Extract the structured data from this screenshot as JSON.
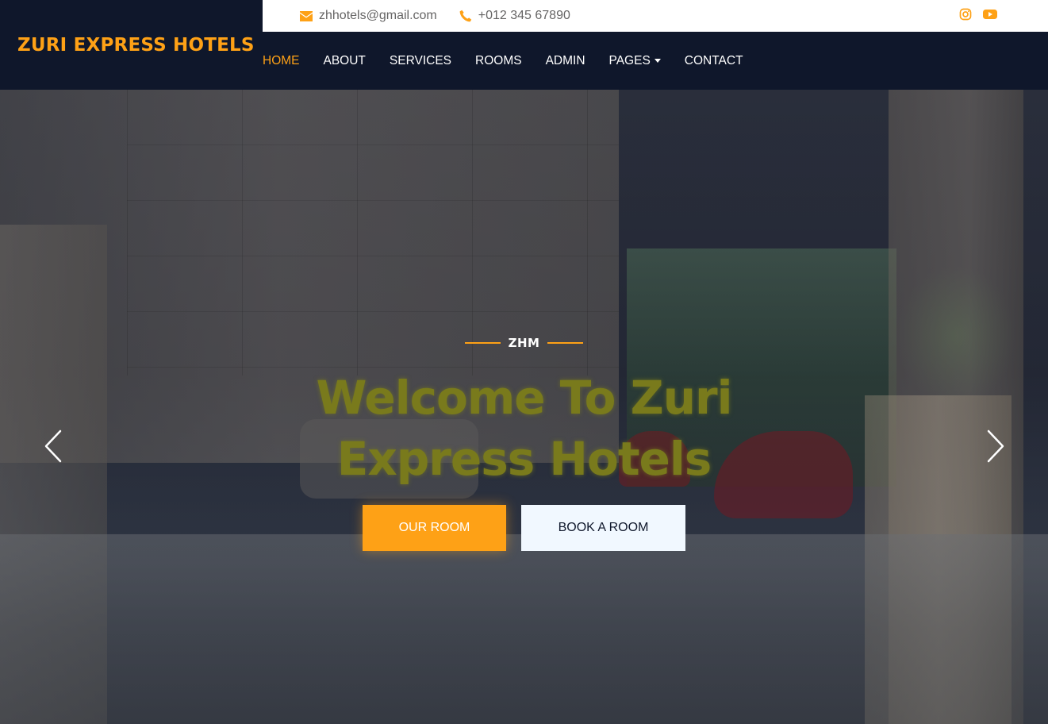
{
  "brand": {
    "name": "ZURI EXPRESS HOTELS"
  },
  "topbar": {
    "email": "zhhotels@gmail.com",
    "phone": "+012 345 67890",
    "socials": [
      "instagram-icon",
      "youtube-icon"
    ]
  },
  "nav": {
    "items": [
      {
        "label": "HOME",
        "active": true
      },
      {
        "label": "ABOUT"
      },
      {
        "label": "SERVICES"
      },
      {
        "label": "ROOMS"
      },
      {
        "label": "ADMIN"
      },
      {
        "label": "PAGES",
        "dropdown": true
      },
      {
        "label": "CONTACT"
      }
    ]
  },
  "hero": {
    "subtitle": "ZHM",
    "headline_line1": "Welcome To Zuri",
    "headline_line2": "Express Hotels",
    "primary_button": "OUR ROOM",
    "secondary_button": "BOOK A ROOM"
  },
  "colors": {
    "accent": "#fea116",
    "navy": "#0f172b",
    "headline": "#797a1c"
  }
}
